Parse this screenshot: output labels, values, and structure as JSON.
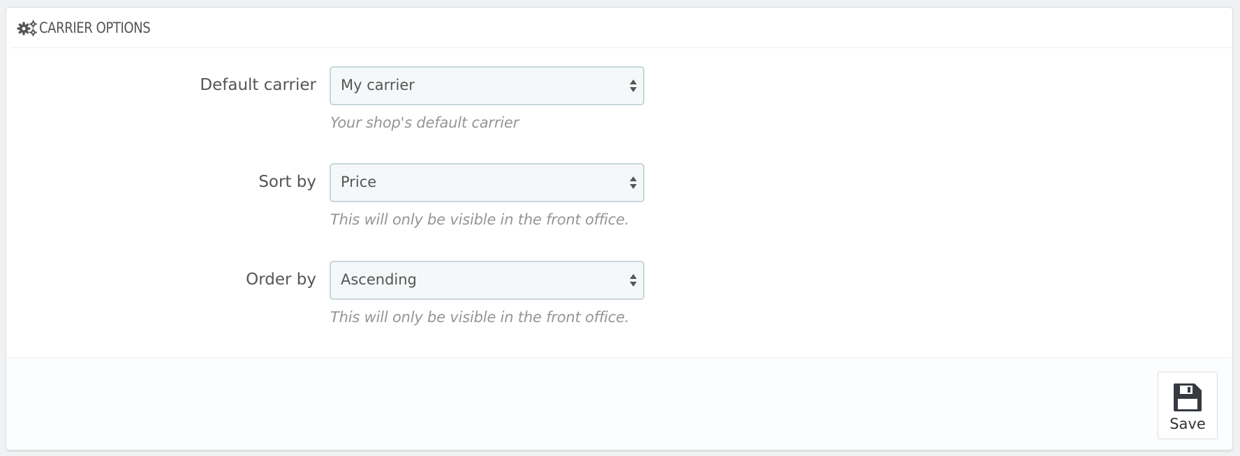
{
  "panel": {
    "title": "CARRIER OPTIONS",
    "icon": "cogs-icon"
  },
  "fields": [
    {
      "label": "Default carrier",
      "value": "My carrier",
      "help": "Your shop's default carrier"
    },
    {
      "label": "Sort by",
      "value": "Price",
      "help": "This will only be visible in the front office."
    },
    {
      "label": "Order by",
      "value": "Ascending",
      "help": "This will only be visible in the front office."
    }
  ],
  "footer": {
    "save_label": "Save",
    "save_icon": "floppy-disk-icon"
  },
  "colors": {
    "select_bg": "#f5f8f9",
    "select_border": "#c7d6db",
    "help_text": "#959595",
    "label_text": "#555555"
  }
}
